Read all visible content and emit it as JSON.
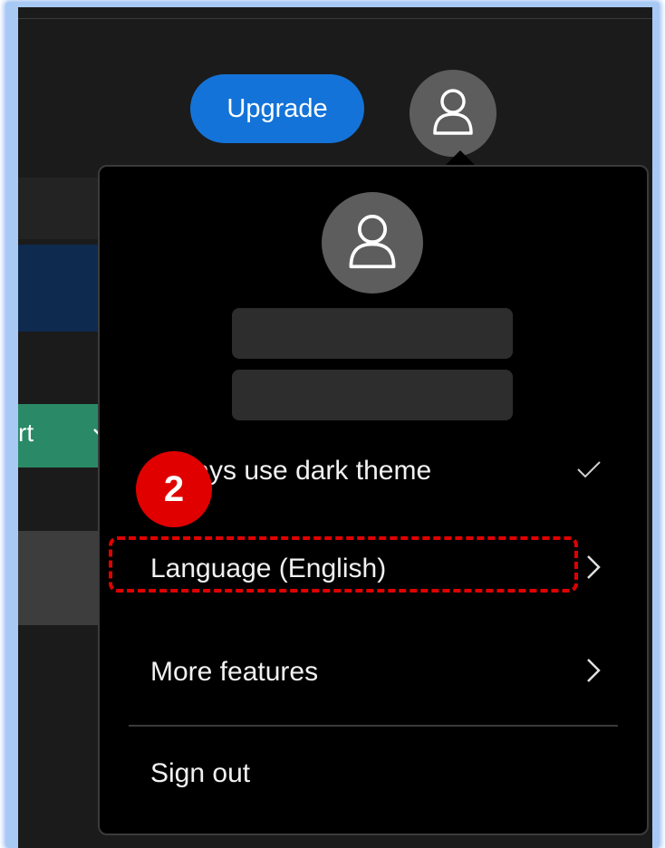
{
  "header": {
    "upgrade_label": "Upgrade",
    "account_icon": "person-icon"
  },
  "background": {
    "button_text": "rt",
    "colors": {
      "blue_band": "#0e2a4e",
      "green_band": "#2a8a68"
    }
  },
  "account_menu": {
    "avatar_icon": "person-icon",
    "items": [
      {
        "label": "Always use dark theme",
        "trailing_icon": "checkmark-icon"
      },
      {
        "label": "Language (English)",
        "trailing_icon": "chevron-right-icon"
      },
      {
        "label": "More features",
        "trailing_icon": "chevron-right-icon"
      },
      {
        "label": "Sign out"
      }
    ]
  },
  "annotation": {
    "step_number": "2",
    "highlight_color": "#e10000"
  },
  "colors": {
    "accent": "#1473d8",
    "menu_background": "#000000",
    "avatar": "#5d5d5d"
  }
}
